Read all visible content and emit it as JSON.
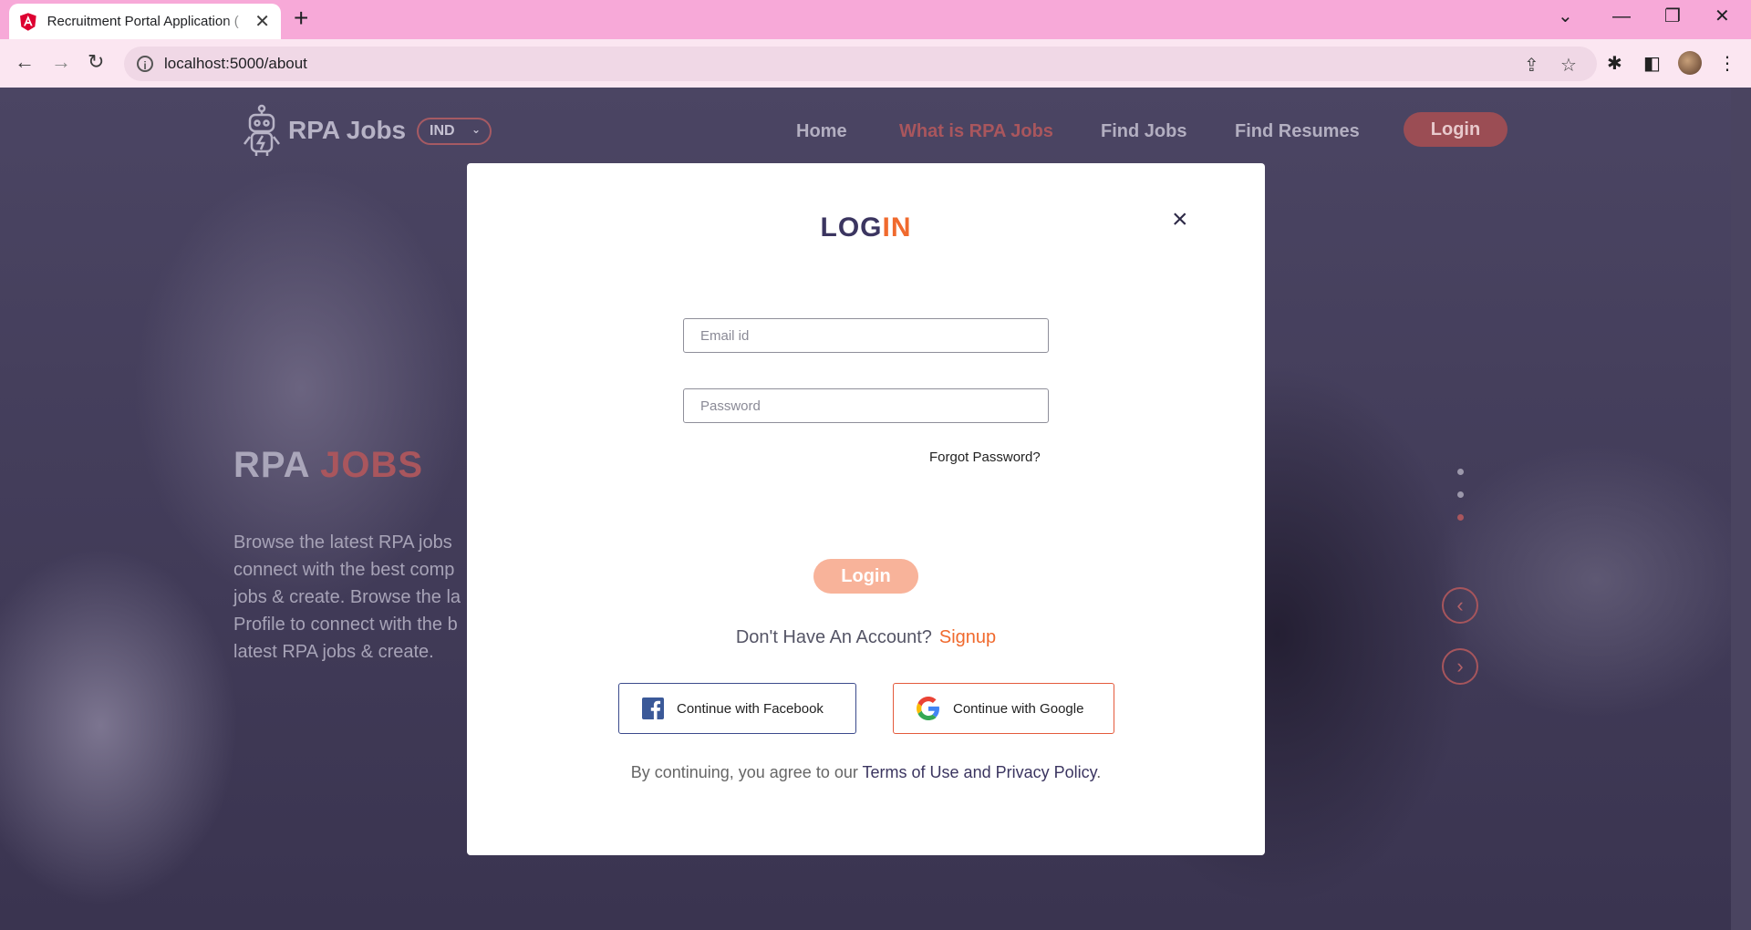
{
  "browser": {
    "tab_title": "Recruitment Portal Application (",
    "url": "localhost:5000/about"
  },
  "site": {
    "logo_text": "RPA Jobs",
    "country": "IND",
    "nav": {
      "home": "Home",
      "what_is": "What is RPA Jobs",
      "find_jobs": "Find Jobs",
      "find_resumes": "Find Resumes",
      "login": "Login"
    },
    "hero": {
      "title_part1": "RPA ",
      "title_part2": "JOBS",
      "line1": "Browse the latest RPA jobs",
      "line2": "connect with the best comp",
      "line3": "jobs & create. Browse the la",
      "line4": "Profile to connect with the b",
      "line5": "latest RPA jobs & create."
    }
  },
  "modal": {
    "title_part1": "LOG",
    "title_part2": "IN",
    "close": "×",
    "email_placeholder": "Email id",
    "password_placeholder": "Password",
    "forgot": "Forgot Password?",
    "login_button": "Login",
    "no_account": "Don't Have An Account?",
    "signup": "Signup",
    "facebook": "Continue with Facebook",
    "google": "Continue with Google",
    "terms_prefix": "By continuing, you agree to our ",
    "terms_link": "Terms of Use and Privacy Policy",
    "terms_suffix": "."
  },
  "colors": {
    "accent_orange": "#f06a2e",
    "title_navy": "#3b3560",
    "tab_strip_pink": "#f7a9d8"
  }
}
